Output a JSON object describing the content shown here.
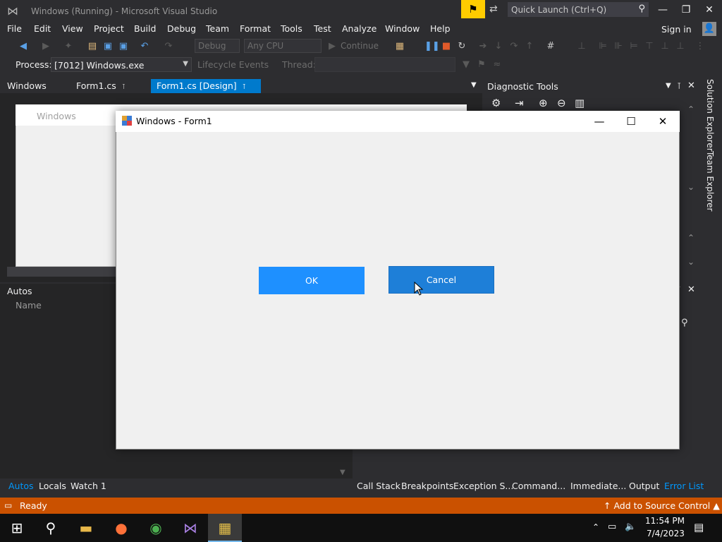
{
  "app": {
    "title": "Windows (Running) - Microsoft Visual Studio",
    "quick_launch_placeholder": "Quick Launch (Ctrl+Q)",
    "sign_in": "Sign in"
  },
  "menu": [
    "File",
    "Edit",
    "View",
    "Project",
    "Build",
    "Debug",
    "Team",
    "Format",
    "Tools",
    "Test",
    "Analyze",
    "Window",
    "Help"
  ],
  "toolbar": {
    "config": "Debug",
    "platform": "Any CPU",
    "continue_label": "Continue"
  },
  "process_bar": {
    "process_label": "Process:",
    "process_value": "[7012] Windows.exe",
    "lifecycle_label": "Lifecycle Events",
    "thread_label": "Thread:"
  },
  "doc_tabs": [
    "Windows",
    "Form1.cs",
    "Form1.cs [Design]"
  ],
  "designer": {
    "form_title": "Windows"
  },
  "diagnostic": {
    "title": "Diagnostic Tools"
  },
  "side_tabs": [
    "Solution Explorer",
    "Team Explorer"
  ],
  "autos": {
    "title": "Autos",
    "column_name": "Name"
  },
  "bottom_tabs_left": [
    "Autos",
    "Locals",
    "Watch 1"
  ],
  "bottom_tabs_right": [
    "Call Stack",
    "Breakpoints",
    "Exception S...",
    "Command...",
    "Immediate...",
    "Output",
    "Error List"
  ],
  "status": {
    "text": "Ready",
    "source_control": "Add to Source Control"
  },
  "clock": {
    "time": "11:54 PM",
    "date": "7/4/2023"
  },
  "form1": {
    "title": "Windows - Form1",
    "ok_label": "OK",
    "cancel_label": "Cancel"
  },
  "colors": {
    "status_bar": "#ca5100",
    "active_tab": "#007acc",
    "ok_button": "#1e90ff",
    "cancel_button": "#1e7fd8"
  }
}
